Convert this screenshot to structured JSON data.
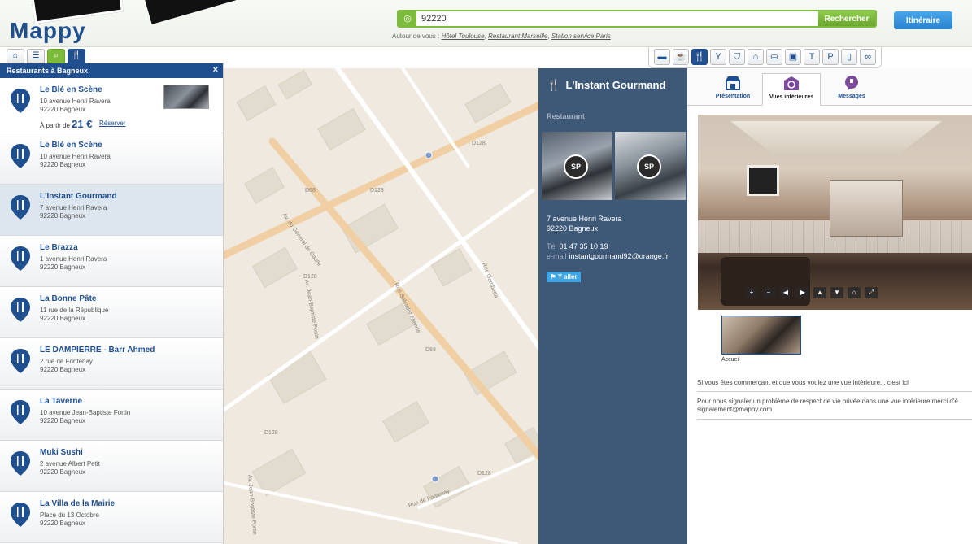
{
  "header": {
    "logo": "Mappy",
    "search": {
      "value": "92220",
      "button": "Rechercher"
    },
    "itinerary_button": "Itinéraire",
    "around": {
      "prefix": "Autour de vous :",
      "links": [
        "Hôtel Toulouse",
        "Restaurant Marseille",
        "Station service Paris"
      ]
    }
  },
  "view_tabs": [
    {
      "icon": "home-icon",
      "glyph": "⌂"
    },
    {
      "icon": "list-icon",
      "glyph": "☰"
    },
    {
      "icon": "search-icon",
      "glyph": "⌕"
    },
    {
      "icon": "fork-knife-icon",
      "glyph": "🍴"
    }
  ],
  "category_bar": [
    {
      "icon": "bed-icon",
      "glyph": "▬"
    },
    {
      "icon": "coffee-icon",
      "glyph": "☕"
    },
    {
      "icon": "restaurant-icon",
      "glyph": "🍴",
      "active": true
    },
    {
      "icon": "bar-icon",
      "glyph": "Y"
    },
    {
      "icon": "culture-icon",
      "glyph": "⛉"
    },
    {
      "icon": "monument-icon",
      "glyph": "⌂"
    },
    {
      "icon": "shopping-icon",
      "glyph": "⛀"
    },
    {
      "icon": "grocery-icon",
      "glyph": "▣"
    },
    {
      "icon": "clothing-icon",
      "glyph": "T"
    },
    {
      "icon": "parking-icon",
      "glyph": "P"
    },
    {
      "icon": "fuel-icon",
      "glyph": "▯"
    },
    {
      "icon": "bike-icon",
      "glyph": "∞"
    }
  ],
  "results": {
    "title": "Restaurants à Bagneux",
    "close": "×",
    "items": [
      {
        "name": "Le Blé en Scène",
        "street": "10 avenue Henri Ravera",
        "city": "92220 Bagneux",
        "price_prefix": "À partir de",
        "price": "21 €",
        "reserve": "Réserver"
      },
      {
        "name": "Le Blé en Scène",
        "street": "10 avenue Henri Ravera",
        "city": "92220 Bagneux"
      },
      {
        "name": "L'Instant Gourmand",
        "street": "7 avenue Henri Ravera",
        "city": "92220 Bagneux"
      },
      {
        "name": "Le Brazza",
        "street": "1 avenue Henri Ravera",
        "city": "92220 Bagneux"
      },
      {
        "name": "La Bonne Pâte",
        "street": "11 rue de la République",
        "city": "92220 Bagneux"
      },
      {
        "name": "LE DAMPIERRE - Barr Ahmed",
        "street": "2 rue de Fontenay",
        "city": "92220 Bagneux"
      },
      {
        "name": "La Taverne",
        "street": "10 avenue Jean-Baptiste Fortin",
        "city": "92220 Bagneux"
      },
      {
        "name": "Muki Sushi",
        "street": "2 avenue Albert Petit",
        "city": "92220 Bagneux"
      },
      {
        "name": "La Villa de la Mairie",
        "street": "Place du 13 Octobre",
        "city": "92220 Bagneux"
      }
    ]
  },
  "map": {
    "road_labels": [
      "D128",
      "D68",
      "D128",
      "D128",
      "D68",
      "D128",
      "D128"
    ],
    "street_labels": [
      "Av. du Général de Gaulle",
      "Av. Jean-Baptiste Fortin",
      "Rue Salvador Allende",
      "Rue Gambetta",
      "Rue de Fontenay",
      "Av. Jean-Baptiste Fortin"
    ]
  },
  "detail": {
    "name": "L'Instant Gourmand",
    "type": "Restaurant",
    "street": "7 avenue Henri Ravera",
    "city": "92220 Bagneux",
    "tel_label": "Tél",
    "tel": "01 47 35 10 19",
    "mail_label": "e-mail",
    "mail": "instantgourmand92@orange.fr",
    "go_button": "Y aller",
    "pano_badge": "SP"
  },
  "content": {
    "tabs": [
      "Présentation",
      "Vues intérieures",
      "Messages"
    ],
    "active_tab": 1,
    "pano_controls": [
      "+",
      "−",
      "◀",
      "▶",
      "▲",
      "▼",
      "⌂",
      "⤢"
    ],
    "thumb_label": "Accueil",
    "merchant_text": "Si vous êtes commerçant et que vous voulez une vue intérieure... c'est ici",
    "privacy_line1": "Pour nous signaler un problème de respect de vie privée dans une vue intérieure merci d'é",
    "privacy_line2": "signalement@mappy.com"
  },
  "colors": {
    "brand_blue": "#1f4f8f",
    "green": "#7dbb3c",
    "panel_blue": "#3e5878",
    "link_blue": "#2a82cf"
  }
}
